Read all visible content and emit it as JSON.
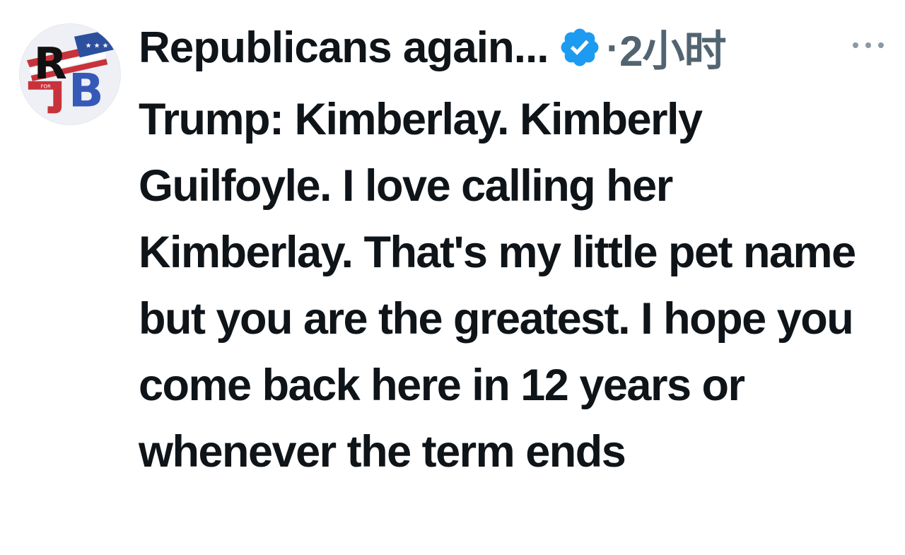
{
  "author": {
    "display_name": "Republicans again...",
    "avatar_icon": "rb-logo-avatar",
    "avatar_letters": "RB",
    "verified": true,
    "badge_color": "#1d9bf0"
  },
  "meta": {
    "separator": "·",
    "time": "2小时",
    "more_icon": "more-horizontal-icon"
  },
  "tweet": {
    "text": "Trump: Kimberlay. Kimberly Guilfoyle. I love calling her Kimberlay. That's my little pet name but you are the greatest. I hope you come back here in 12 years or whenever the term ends"
  },
  "colors": {
    "text_primary": "#0f1419",
    "text_secondary": "#536471",
    "verified_blue": "#1d9bf0"
  }
}
